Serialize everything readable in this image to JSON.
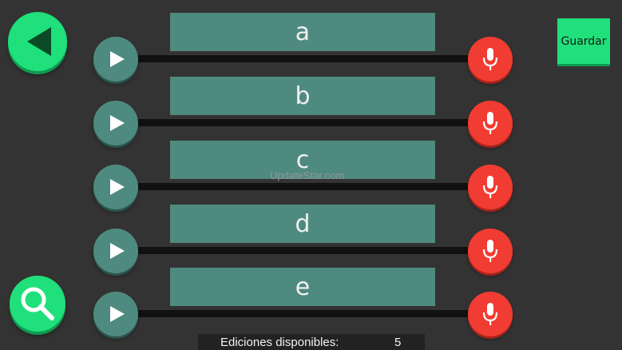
{
  "header": {
    "back_icon": "back-arrow-icon",
    "save_label": "Guardar"
  },
  "rows": [
    {
      "label": "a",
      "play_icon": "play-icon",
      "mic_icon": "microphone-icon"
    },
    {
      "label": "b",
      "play_icon": "play-icon",
      "mic_icon": "microphone-icon"
    },
    {
      "label": "c",
      "play_icon": "play-icon",
      "mic_icon": "microphone-icon"
    },
    {
      "label": "d",
      "play_icon": "play-icon",
      "mic_icon": "microphone-icon"
    },
    {
      "label": "e",
      "play_icon": "play-icon",
      "mic_icon": "microphone-icon"
    }
  ],
  "search": {
    "icon": "search-icon"
  },
  "footer": {
    "label": "Ediciones disponibles:",
    "count": "5"
  },
  "watermark": "UpdateStar.com",
  "colors": {
    "background": "#333333",
    "accent_green": "#1fe07a",
    "teal": "#4f8a80",
    "record_red": "#f03c32"
  }
}
